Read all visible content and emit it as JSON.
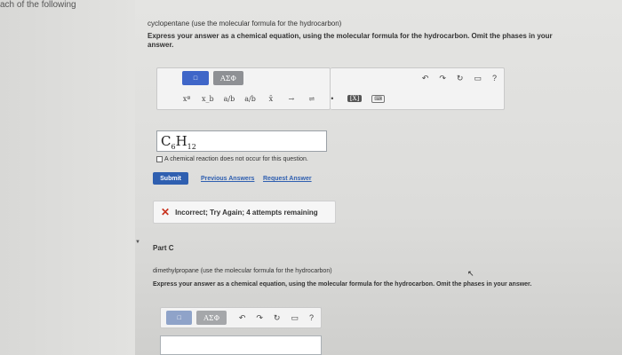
{
  "edge_text": "ach of the following",
  "part_b": {
    "prompt": "cyclopentane (use the molecular formula for the hydrocarbon)",
    "instruction": "Express your answer as a chemical equation, using the molecular formula for the hydrocarbon. Omit the phases in your answer.",
    "toolbar": {
      "template_btn": "□",
      "greek_btn": "ΑΣΦ",
      "undo": "↶",
      "redo": "↷",
      "reset": "↻",
      "keyboard": "▭",
      "help": "?",
      "row2": [
        "x^a",
        "x_b",
        "a/b",
        "a/b",
        "x",
        "→",
        "⇌",
        "•",
        "[X]",
        "kbd"
      ],
      "row2_display": [
        "xª",
        "x_b",
        "a/b",
        "a/b",
        "x̄",
        "→",
        "⇌",
        "•",
        "[X]",
        "⌨"
      ]
    },
    "answer": {
      "c": "C",
      "c_sub": "6",
      "h": "H",
      "h_sub": "12"
    },
    "no_reaction_label": "A chemical reaction does not occur for this question.",
    "submit_label": "Submit",
    "prev_answers_label": "Previous Answers",
    "request_answer_label": "Request Answer",
    "feedback": "Incorrect; Try Again; 4 attempts remaining"
  },
  "part_c": {
    "title": "Part C",
    "prompt": "dimethylpropane (use the molecular formula for the hydrocarbon)",
    "instruction": "Express your answer as a chemical equation, using the molecular formula for the hydrocarbon. Omit the phases in your answer.",
    "toolbar": {
      "template_btn": "□",
      "greek_btn": "ΑΣΦ",
      "undo": "↶",
      "redo": "↷",
      "reset": "↻",
      "keyboard": "▭",
      "help": "?"
    }
  }
}
